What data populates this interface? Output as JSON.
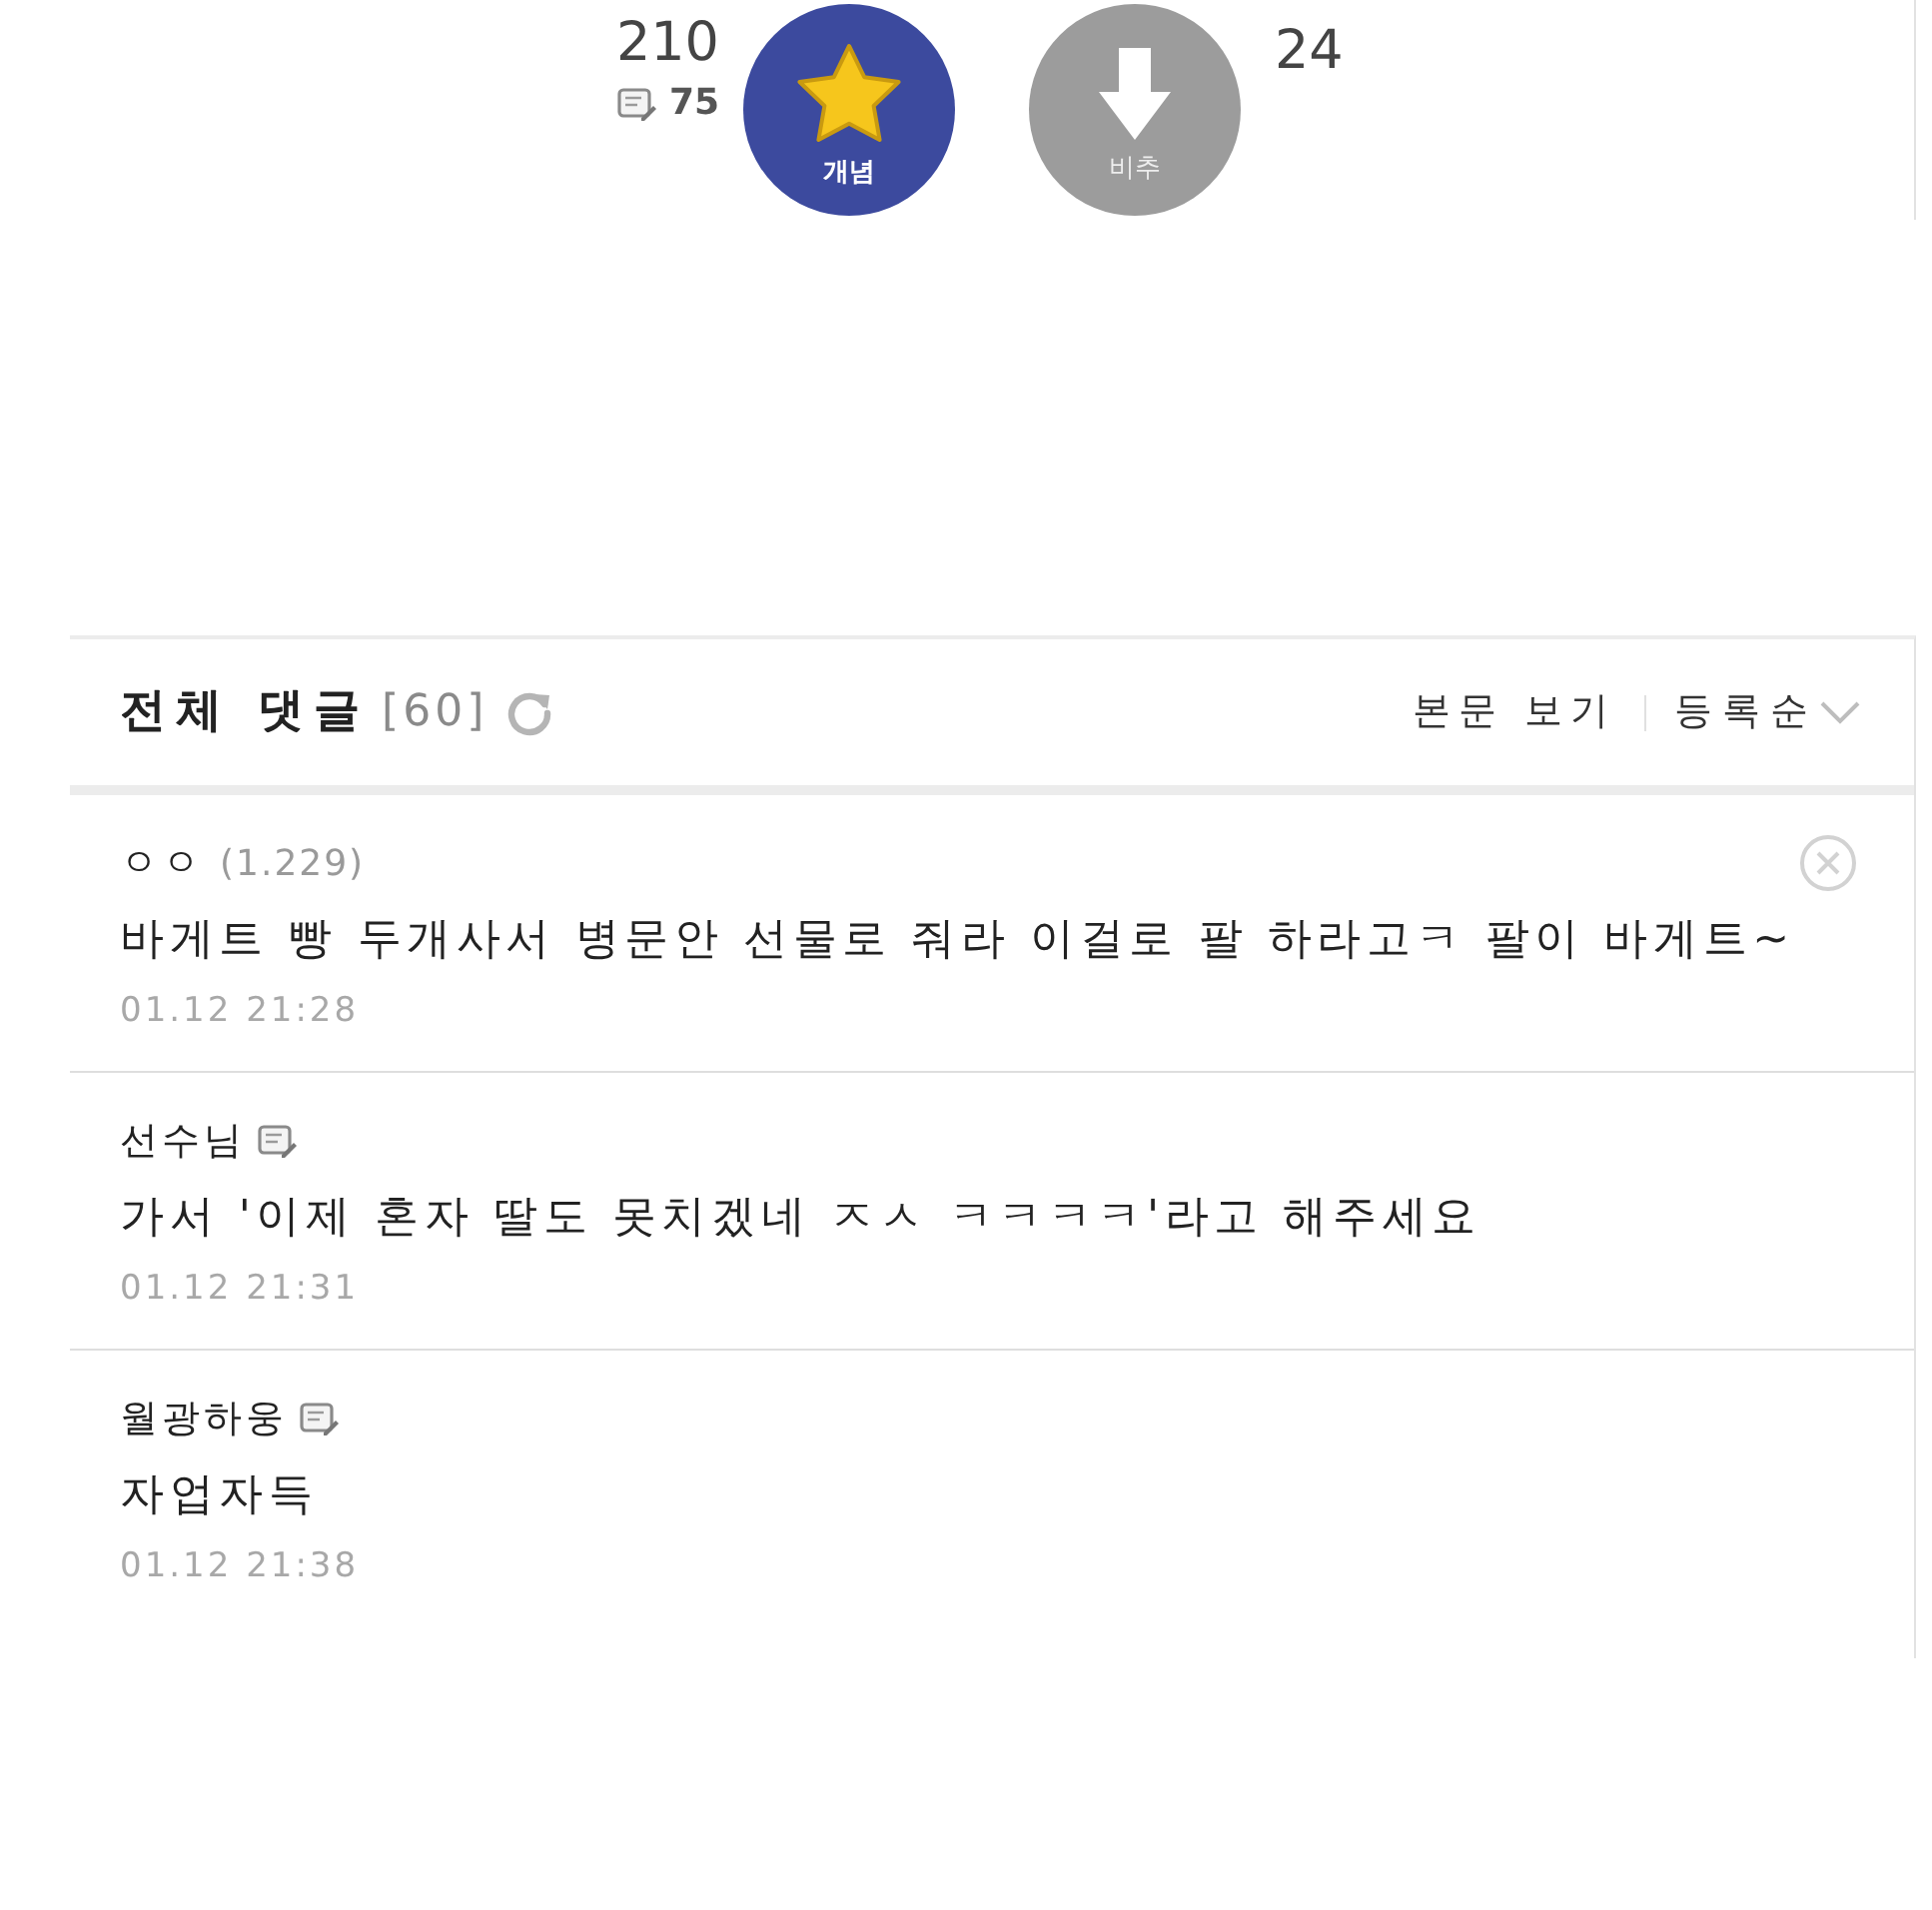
{
  "vote": {
    "up_count": "210",
    "comment_count": "75",
    "up_label": "개념",
    "down_label": "비추",
    "down_count": "24"
  },
  "comments_header": {
    "title": "전체 댓글",
    "count": "[60]",
    "view_post": "본문 보기",
    "sort": "등록순"
  },
  "comments": [
    {
      "author": "ㅇㅇ",
      "ip": "(1.229)",
      "member": false,
      "deletable": true,
      "text": "바게트 빵 두개사서 병문안 선물로 줘라 이걸로 팔 하라고ㅋ 팔이 바게트~",
      "date": "01.12 21:28"
    },
    {
      "author": "선수님",
      "member": true,
      "deletable": false,
      "text": "가서 '이제 혼자 딸도 못치겠네 ㅈㅅ ㅋㅋㅋㅋ'라고 해주세요",
      "date": "01.12 21:31"
    },
    {
      "author": "월광하웅",
      "member": true,
      "deletable": false,
      "text": "자업자득",
      "date": "01.12 21:38"
    }
  ]
}
